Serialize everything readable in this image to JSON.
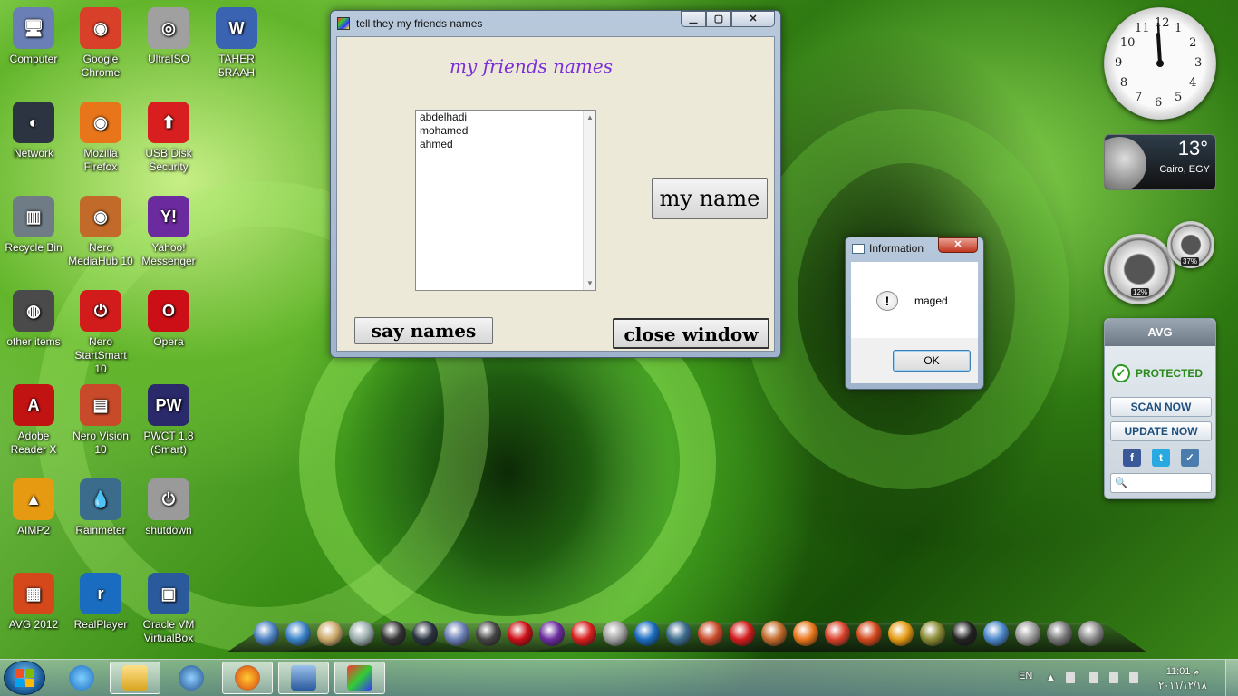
{
  "desktop": {
    "icons": [
      {
        "label": "Computer",
        "glyph": "🖥",
        "color": "#6a7fb5"
      },
      {
        "label": "Google Chrome",
        "glyph": "◉",
        "color": "#d8402a"
      },
      {
        "label": "UltraISO",
        "glyph": "◎",
        "color": "#a0a0a0"
      },
      {
        "label": "TAHER 5RAAH",
        "glyph": "W",
        "color": "#3a64b2"
      },
      {
        "label": "Network",
        "glyph": "◐",
        "color": "#2b3440"
      },
      {
        "label": "Mozilla Firefox",
        "glyph": "◉",
        "color": "#e8751a"
      },
      {
        "label": "USB Disk Security",
        "glyph": "⬆",
        "color": "#d81e1e"
      },
      {
        "label": "Recycle Bin",
        "glyph": "▥",
        "color": "#6f7c86"
      },
      {
        "label": "Nero MediaHub 10",
        "glyph": "◉",
        "color": "#c26a2a"
      },
      {
        "label": "Yahoo! Messenger",
        "glyph": "Y!",
        "color": "#6b2b9e"
      },
      {
        "label": "other items",
        "glyph": "◍",
        "color": "#4a4a4a"
      },
      {
        "label": "Nero StartSmart 10",
        "glyph": "⏻",
        "color": "#d21c1c"
      },
      {
        "label": "Opera",
        "glyph": "O",
        "color": "#cc0f16"
      },
      {
        "label": "Adobe Reader X",
        "glyph": "A",
        "color": "#c21313"
      },
      {
        "label": "Nero Vision 10",
        "glyph": "▤",
        "color": "#c84a2a"
      },
      {
        "label": "PWCT 1.8 (Smart)",
        "glyph": "PW",
        "color": "#2a2a6a"
      },
      {
        "label": "AIMP2",
        "glyph": "▲",
        "color": "#e59a12"
      },
      {
        "label": "Rainmeter",
        "glyph": "💧",
        "color": "#3c6c8c"
      },
      {
        "label": "shutdown",
        "glyph": "⏻",
        "color": "#9a9a9a"
      },
      {
        "label": "AVG 2012",
        "glyph": "▦",
        "color": "#d4481c"
      },
      {
        "label": "RealPlayer",
        "glyph": "r",
        "color": "#1a6cc0"
      },
      {
        "label": "Oracle VM VirtualBox",
        "glyph": "▣",
        "color": "#2a5a9c"
      }
    ]
  },
  "main_window": {
    "title": "tell they my friends names",
    "minimize": "▁",
    "maximize": "▢",
    "close": "✕",
    "heading": "my friends names",
    "friends": [
      "abdelhadi",
      "mohamed",
      "ahmed"
    ],
    "my_name_button": "my name",
    "say_names_button": "say names",
    "close_window_button": "close window"
  },
  "info_dialog": {
    "title": "Information",
    "close": "✕",
    "message": "maged",
    "ok_button": "OK",
    "icon": "!"
  },
  "gadgets": {
    "clock_numbers": [
      "12",
      "1",
      "2",
      "3",
      "4",
      "5",
      "6",
      "7",
      "8",
      "9",
      "10",
      "11"
    ],
    "weather_temp": "13°",
    "weather_city": "Cairo, EGY",
    "cpu_percent": "12%",
    "ram_percent": "37%",
    "avg": {
      "title": "AVG",
      "status": "PROTECTED",
      "scan_button": "SCAN NOW",
      "update_button": "UPDATE NOW",
      "social": [
        "f",
        "t",
        "✓"
      ]
    }
  },
  "taskbar": {
    "language": "EN",
    "time": "11:01 م",
    "date": "٢٠١١/١٢/١٨"
  },
  "colors": {
    "accent_purple": "#7a2ddb",
    "avg_green": "#2a8a1e"
  }
}
